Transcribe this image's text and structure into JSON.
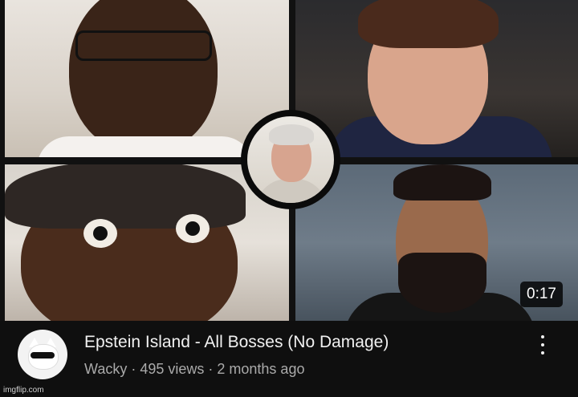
{
  "video": {
    "duration": "0:17",
    "title": "Epstein Island - All Bosses (No Damage)",
    "channel": "Wacky",
    "views": "495 views",
    "age": "2 months ago",
    "meta_separator": " · "
  },
  "menu": {
    "icon": "more-vertical-icon"
  },
  "channel_avatar": {
    "icon": "cat-with-sunglasses-avatar"
  },
  "watermark": "imgflip.com",
  "colors": {
    "background": "#0f0f0f",
    "title": "#f1f1f1",
    "meta": "#aaaaaa",
    "duration_bg": "#000000cc"
  }
}
